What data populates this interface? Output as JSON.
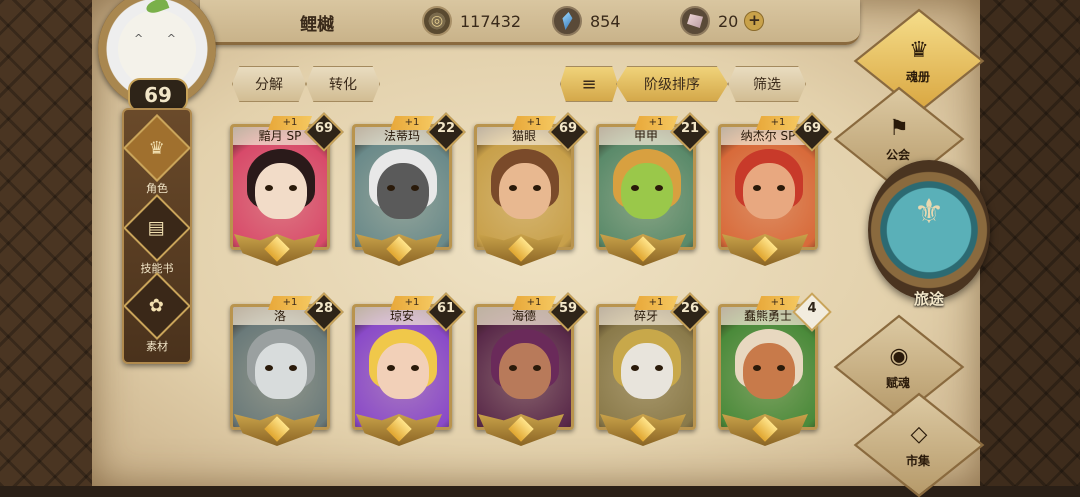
{
  "player": {
    "name": "鲤樾",
    "level": "69"
  },
  "resources": {
    "gold": "117432",
    "crystal": "854",
    "shard": "20"
  },
  "toolbar": {
    "decompose": "分解",
    "convert": "转化",
    "sort_label": "阶级排序",
    "filter": "筛选"
  },
  "left_nav": [
    {
      "label": "角色",
      "icon": "mask-icon"
    },
    {
      "label": "技能书",
      "icon": "book-icon"
    },
    {
      "label": "素材",
      "icon": "material-icon"
    }
  ],
  "right_nav": {
    "soul_book": "魂册",
    "guild": "公会",
    "journey": "旅途",
    "endow": "赋魂",
    "market": "市集"
  },
  "cards": [
    {
      "name": "黯月 SP",
      "level": "69",
      "plus": "+1",
      "skin": "#f2dcc8",
      "hair": "#2a1a1a",
      "bg": "#d84a6a"
    },
    {
      "name": "法蒂玛",
      "level": "22",
      "plus": "+1",
      "skin": "#5a5a5a",
      "hair": "#e8e8e8",
      "bg": "#6a8a8a"
    },
    {
      "name": "猫眼",
      "level": "69",
      "plus": "+1",
      "skin": "#e8b890",
      "hair": "#7a4a2a",
      "bg": "#c8a04a"
    },
    {
      "name": "甲甲",
      "level": "21",
      "plus": "+1",
      "skin": "#9ac84a",
      "hair": "#d8a040",
      "bg": "#5a8a6a"
    },
    {
      "name": "纳杰尔 SP",
      "level": "69",
      "plus": "+1",
      "skin": "#e8a880",
      "hair": "#c83a2a",
      "bg": "#d86a3a"
    },
    {
      "name": "洛",
      "level": "28",
      "plus": "+1",
      "skin": "#d8dcdc",
      "hair": "#9aa0a0",
      "bg": "#6a7a7a"
    },
    {
      "name": "琼安",
      "level": "61",
      "plus": "+1",
      "skin": "#f2d0b8",
      "hair": "#f0c84a",
      "bg": "#8a4ac8"
    },
    {
      "name": "海德",
      "level": "59",
      "plus": "+1",
      "skin": "#b87a5a",
      "hair": "#6a2a5a",
      "bg": "#5a2a4a"
    },
    {
      "name": "碎牙",
      "level": "26",
      "plus": "+1",
      "skin": "#e8e4dc",
      "hair": "#c8a84a",
      "bg": "#8a7a4a"
    },
    {
      "name": "蠢熊勇士",
      "level": "4",
      "plus": "+1",
      "skin": "#c87a4a",
      "hair": "#e8d8c0",
      "bg": "#4a8a3a"
    }
  ]
}
